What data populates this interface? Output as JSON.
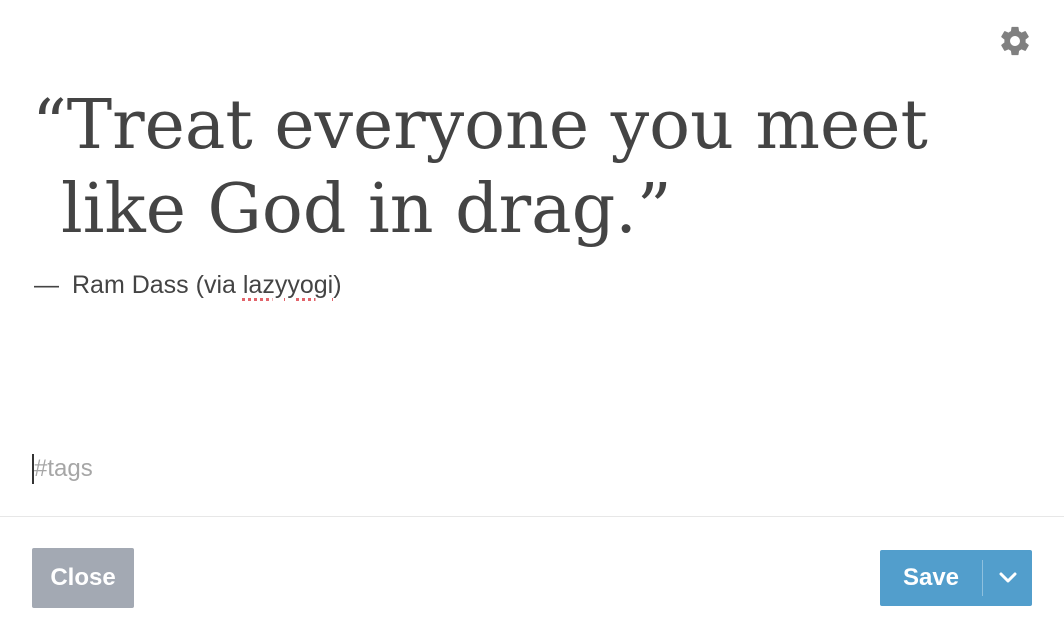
{
  "editor": {
    "quote": {
      "text": "“Treat everyone you meet like God in drag.”"
    },
    "source": {
      "dash": "—",
      "prefix": "Ram Dass (via ",
      "link_text": "lazyyogi",
      "suffix": ")"
    },
    "tags": {
      "placeholder": "#tags"
    }
  },
  "toolbar": {
    "settings_icon": "gear-icon",
    "close_label": "Close",
    "save_label": "Save",
    "save_menu_icon": "chevron-down-icon"
  },
  "colors": {
    "text": "#444444",
    "close_button": "#a3a9b3",
    "save_button": "#529ecc",
    "gear": "#808080",
    "spellcheck_underline": "#e2646b"
  }
}
